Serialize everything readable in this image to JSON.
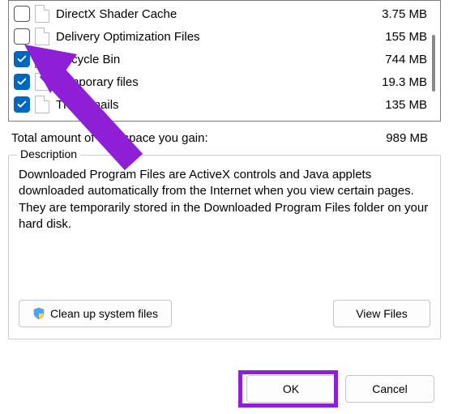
{
  "list": {
    "items": [
      {
        "label": "DirectX Shader Cache",
        "size": "3.75 MB",
        "checked": false,
        "iconType": "file"
      },
      {
        "label": "Delivery Optimization Files",
        "size": "155 MB",
        "checked": false,
        "iconType": "file"
      },
      {
        "label": "Recycle Bin",
        "size": "744 MB",
        "checked": true,
        "iconType": "recycle"
      },
      {
        "label": "Temporary files",
        "size": "19.3 MB",
        "checked": true,
        "iconType": "file"
      },
      {
        "label": "Thumbnails",
        "size": "135 MB",
        "checked": true,
        "iconType": "file"
      }
    ]
  },
  "total": {
    "label": "Total amount of disk space you gain:",
    "value": "989 MB"
  },
  "description": {
    "legend": "Description",
    "text": "Downloaded Program Files are ActiveX controls and Java applets downloaded automatically from the Internet when you view certain pages. They are temporarily stored in the Downloaded Program Files folder on your hard disk."
  },
  "buttons": {
    "cleanup": "Clean up system files",
    "viewfiles": "View Files",
    "ok": "OK",
    "cancel": "Cancel"
  },
  "annotation": {
    "color": "#8e1fd6"
  }
}
